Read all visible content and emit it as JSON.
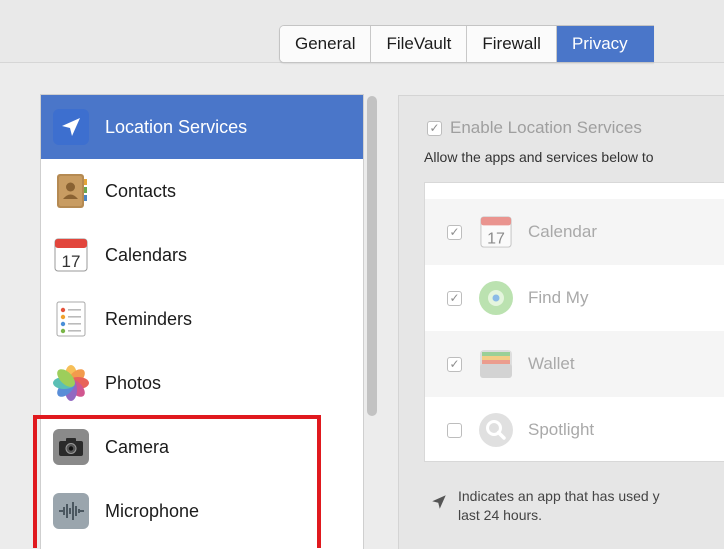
{
  "tabs": [
    {
      "label": "General",
      "active": false
    },
    {
      "label": "FileVault",
      "active": false
    },
    {
      "label": "Firewall",
      "active": false
    },
    {
      "label": "Privacy",
      "active": true
    }
  ],
  "sidebar": {
    "items": [
      {
        "label": "Location Services",
        "icon": "location-arrow-icon",
        "selected": true
      },
      {
        "label": "Contacts",
        "icon": "contacts-icon",
        "selected": false
      },
      {
        "label": "Calendars",
        "icon": "calendar-icon",
        "selected": false
      },
      {
        "label": "Reminders",
        "icon": "reminders-icon",
        "selected": false
      },
      {
        "label": "Photos",
        "icon": "photos-icon",
        "selected": false
      },
      {
        "label": "Camera",
        "icon": "camera-icon",
        "selected": false
      },
      {
        "label": "Microphone",
        "icon": "microphone-icon",
        "selected": false
      }
    ]
  },
  "main": {
    "enable_label": "Enable Location Services",
    "enable_checked": true,
    "allow_text": "Allow the apps and services below to",
    "apps": [
      {
        "name": "Calendar",
        "icon": "calendar-icon",
        "checked": true
      },
      {
        "name": "Find My",
        "icon": "find-my-icon",
        "checked": true
      },
      {
        "name": "Wallet",
        "icon": "wallet-icon",
        "checked": true
      },
      {
        "name": "Spotlight",
        "icon": "spotlight-icon",
        "checked": false
      }
    ],
    "calendar_day": "17",
    "note_line1": "Indicates an app that has used y",
    "note_line2": "last 24 hours."
  },
  "colors": {
    "accent": "#4a76c9",
    "highlight": "#e0191e"
  }
}
